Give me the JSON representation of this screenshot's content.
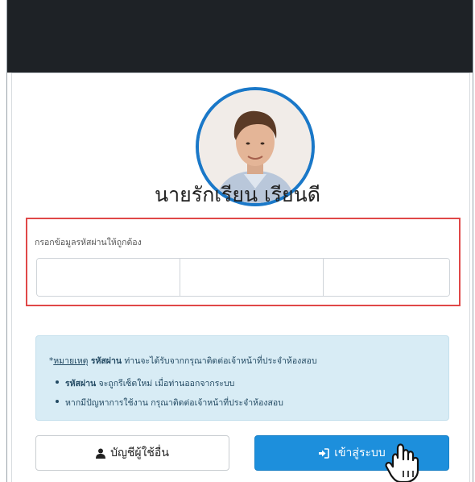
{
  "user": {
    "name": "นายรักเรียน เรียนดี"
  },
  "password_box": {
    "label": "กรอกข้อมูลรหัสผ่านให้ถูกต้อง",
    "cell_count": 4
  },
  "note": {
    "prefix": "*",
    "remark_label": "หมายเหตุ",
    "keyword": "รหัสผ่าน",
    "message": "ท่านจะได้รับจากกรุณาติดต่อเจ้าหน้าที่ประจำห้องสอบ",
    "items": [
      {
        "keyword": "รหัสผ่าน",
        "text": "จะถูกรีเซ็ตใหม่ เมื่อท่านออกจากระบบ"
      },
      {
        "keyword": "",
        "text": "หากมีปัญหาการใช้งาน กรุณาติดต่อเจ้าหน้าที่ประจำห้องสอบ"
      }
    ]
  },
  "buttons": {
    "other_account": {
      "label": "บัญชีผู้ใช้อื่น",
      "icon": "user-icon"
    },
    "login": {
      "label": "เข้าสู่ระบบ",
      "icon": "sign-in-icon"
    }
  },
  "colors": {
    "header_dark": "#1e2226",
    "accent_blue": "#1d8fdc",
    "alert_red": "#e04848",
    "info_bg": "#d8ecf5"
  }
}
